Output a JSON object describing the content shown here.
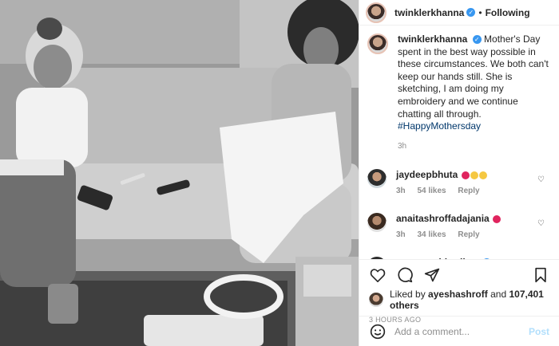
{
  "header": {
    "username": "twinklerkhanna",
    "verified_icon": "verified-badge-icon",
    "separator": "•",
    "follow_status": "Following"
  },
  "caption": {
    "username": "twinklerkhanna",
    "text": "Mother's Day spent in the best way possible in these circumstances. We both can't keep our hands still. She is sketching, I am doing my embroidery and we continue chatting all through.",
    "hashtag": "#HappyMothersday",
    "time": "3h"
  },
  "comments": [
    {
      "username": "jaydeepbhuta",
      "time": "3h",
      "likes": "54 likes",
      "reply": "Reply"
    },
    {
      "username": "anaitashroffadajania",
      "time": "3h",
      "likes": "34 likes",
      "reply": "Reply"
    },
    {
      "username": "namratashirodkar"
    }
  ],
  "actions": {
    "liked_prefix": "Liked by",
    "liked_user": "ayeshashroff",
    "liked_and": "and",
    "liked_count": "107,401 others",
    "timestamp": "3 HOURS AGO"
  },
  "add_comment": {
    "placeholder": "Add a comment...",
    "post_label": "Post"
  },
  "colors": {
    "link": "#00376b",
    "verified": "#3897f0",
    "muted": "#8e8e8e",
    "post_button": "#b2dffc"
  }
}
